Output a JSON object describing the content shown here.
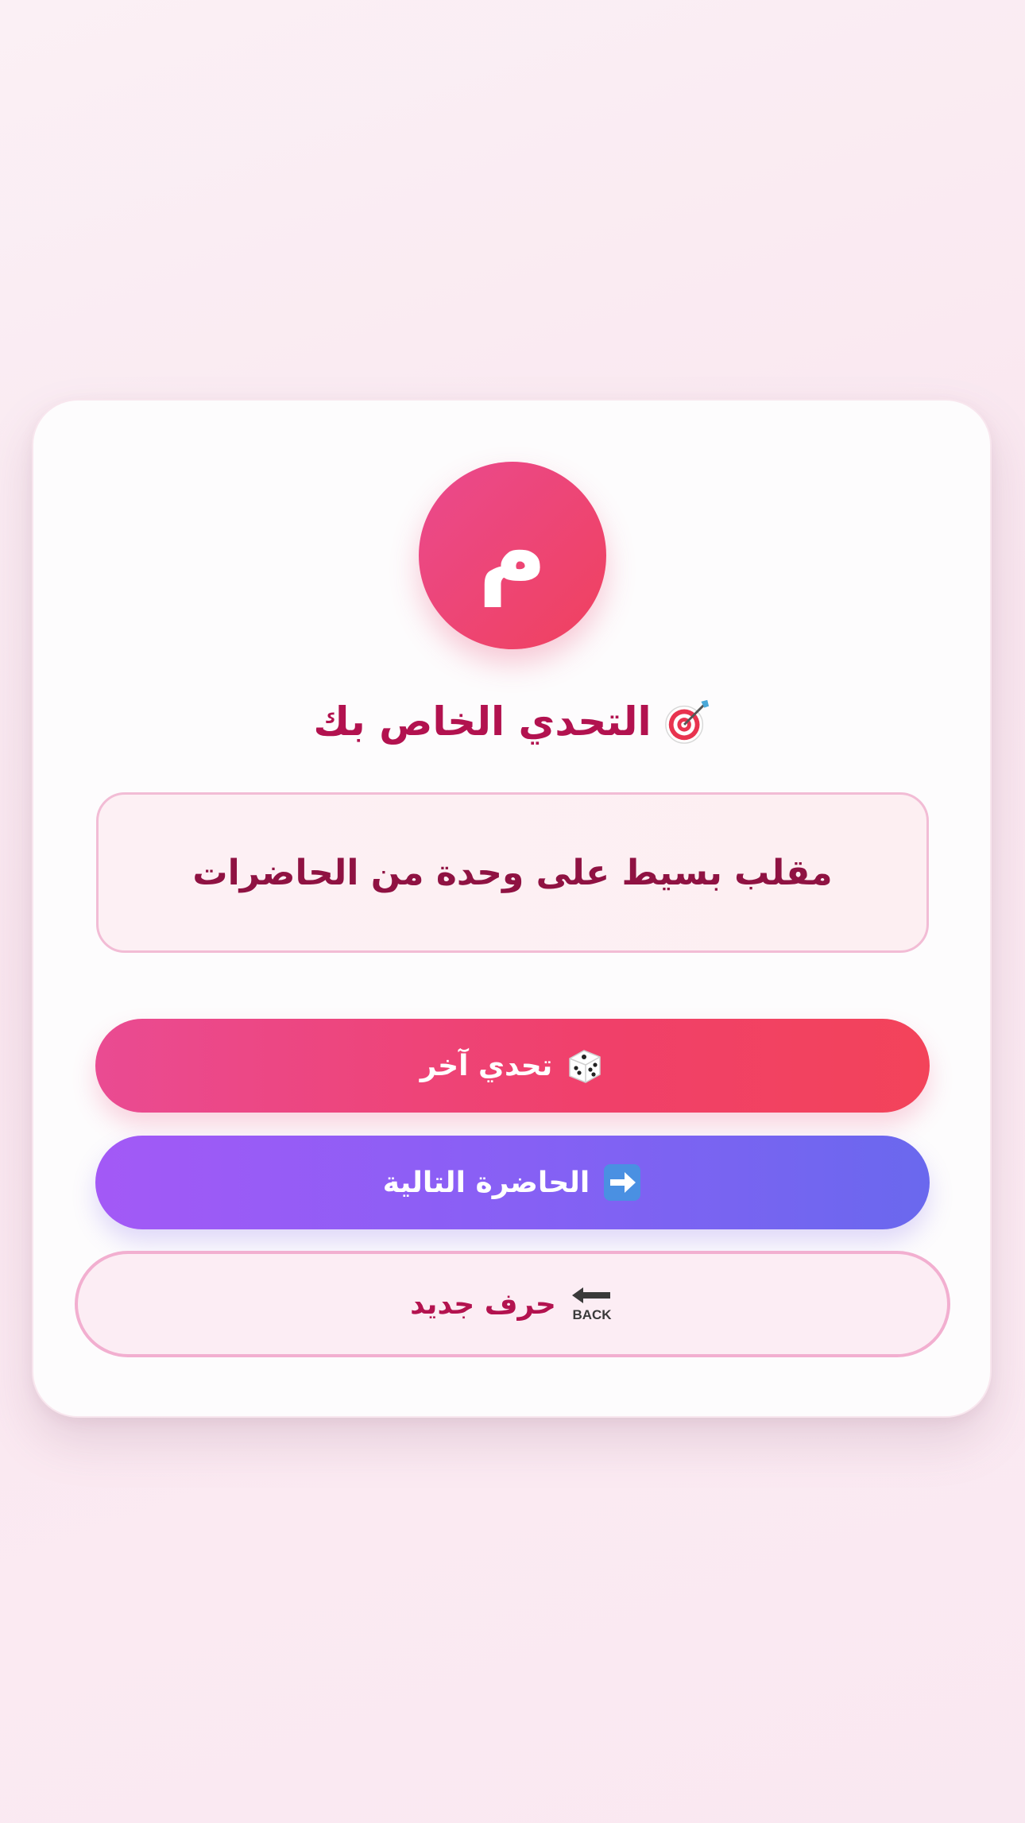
{
  "avatar": {
    "letter": "م"
  },
  "title": {
    "text": "التحدي الخاص بك",
    "icon": "target-icon"
  },
  "challenge": {
    "text": "مقلب بسيط على وحدة من الحاضرات"
  },
  "buttons": {
    "another_challenge": {
      "label": "تحدي آخر",
      "icon": "dice-icon"
    },
    "next_attendee": {
      "label": "الحاضرة التالية",
      "icon": "arrow-right-icon"
    },
    "new_letter": {
      "label": "حرف جديد",
      "icon": "back-arrow-icon",
      "icon_text": "BACK"
    }
  },
  "colors": {
    "accent_pink": "#ea4a8e",
    "accent_red": "#f0415e",
    "accent_purple": "#a359f6",
    "accent_indigo": "#6a68ee",
    "title_color": "#b2124f",
    "challenge_text": "#8f1242"
  }
}
